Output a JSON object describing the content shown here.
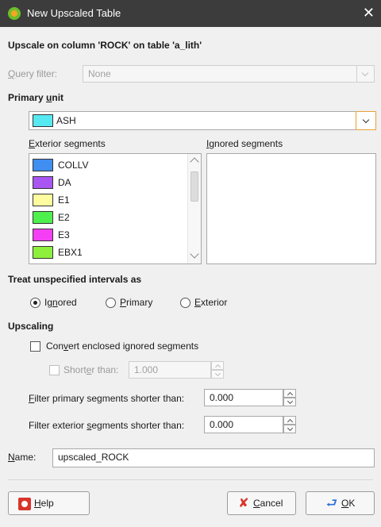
{
  "window": {
    "title": "New Upscaled Table",
    "close_glyph": "✕"
  },
  "header": "Upscale on column 'ROCK' on table 'a_lith'",
  "query_filter": {
    "label_prefix": "",
    "label_access": "Q",
    "label_rest": "uery filter:",
    "value": "None"
  },
  "primary_unit": {
    "label_main": "Primary ",
    "label_access": "u",
    "label_rest": "nit",
    "value": "ASH",
    "color": "#56e9f2"
  },
  "exterior_segments": {
    "label_access": "E",
    "label_rest": "xterior segments",
    "items": [
      {
        "name": "COLLV",
        "color": "#3f8ef0"
      },
      {
        "name": "DA",
        "color": "#a855f2"
      },
      {
        "name": "E1",
        "color": "#fdfda0"
      },
      {
        "name": "E2",
        "color": "#4ef04e"
      },
      {
        "name": "E3",
        "color": "#f53ff5"
      },
      {
        "name": "EBX1",
        "color": "#8ef03c"
      }
    ]
  },
  "ignored_segments": {
    "label_access": "I",
    "label_rest": "gnored segments",
    "items": []
  },
  "unspecified": {
    "label": "Treat unspecified intervals as",
    "options": [
      {
        "pre": "Ig",
        "access": "n",
        "post": "ored",
        "selected": true
      },
      {
        "pre": "",
        "access": "P",
        "post": "rimary",
        "selected": false
      },
      {
        "pre": "",
        "access": "E",
        "post": "xterior",
        "selected": false
      }
    ]
  },
  "upscaling": {
    "label": "Upscaling",
    "convert_pre": "Con",
    "convert_access": "v",
    "convert_post": "ert enclosed ignored segments",
    "shorter_pre": "Short",
    "shorter_access": "e",
    "shorter_post": "r than:",
    "shorter_value": "1.000",
    "filter_primary_access": "F",
    "filter_primary_rest": "ilter primary segments shorter than:",
    "filter_primary_value": "0.000",
    "filter_exterior_pre": "Filter exterior ",
    "filter_exterior_access": "s",
    "filter_exterior_post": "egments shorter than:",
    "filter_exterior_value": "0.000"
  },
  "name": {
    "label_access": "N",
    "label_rest": "ame:",
    "value": "upscaled_ROCK"
  },
  "buttons": {
    "help_access": "H",
    "help_rest": "elp",
    "cancel_access": "C",
    "cancel_rest": "ancel",
    "ok_pre": "",
    "ok_access": "O",
    "ok_rest": "K"
  }
}
